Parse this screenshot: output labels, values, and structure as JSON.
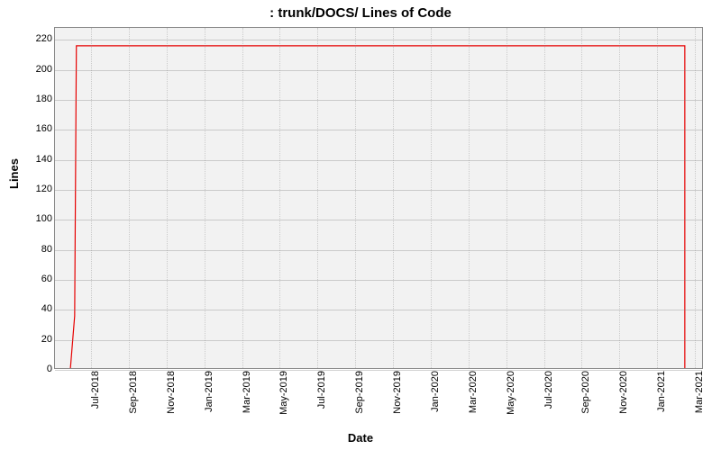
{
  "chart_data": {
    "type": "line",
    "title": ": trunk/DOCS/ Lines of Code",
    "xlabel": "Date",
    "ylabel": "Lines",
    "ylim": [
      0,
      228
    ],
    "y_ticks": [
      0,
      20,
      40,
      60,
      80,
      100,
      120,
      140,
      160,
      180,
      200,
      220
    ],
    "x_ticks": [
      "Jul-2018",
      "Sep-2018",
      "Nov-2018",
      "Jan-2019",
      "Mar-2019",
      "May-2019",
      "Jul-2019",
      "Sep-2019",
      "Nov-2019",
      "Jan-2020",
      "Mar-2020",
      "May-2020",
      "Jul-2020",
      "Sep-2020",
      "Nov-2020",
      "Jan-2021",
      "Mar-2021"
    ],
    "series": [
      {
        "name": "Lines of Code",
        "color": "#e60000",
        "points": [
          {
            "x": "2018-05-15",
            "y": 0
          },
          {
            "x": "2018-05-22",
            "y": 35
          },
          {
            "x": "2018-05-25",
            "y": 216
          },
          {
            "x": "2021-03-15",
            "y": 216
          },
          {
            "x": "2021-03-15",
            "y": 0
          }
        ]
      }
    ],
    "x_range_months": 35
  }
}
